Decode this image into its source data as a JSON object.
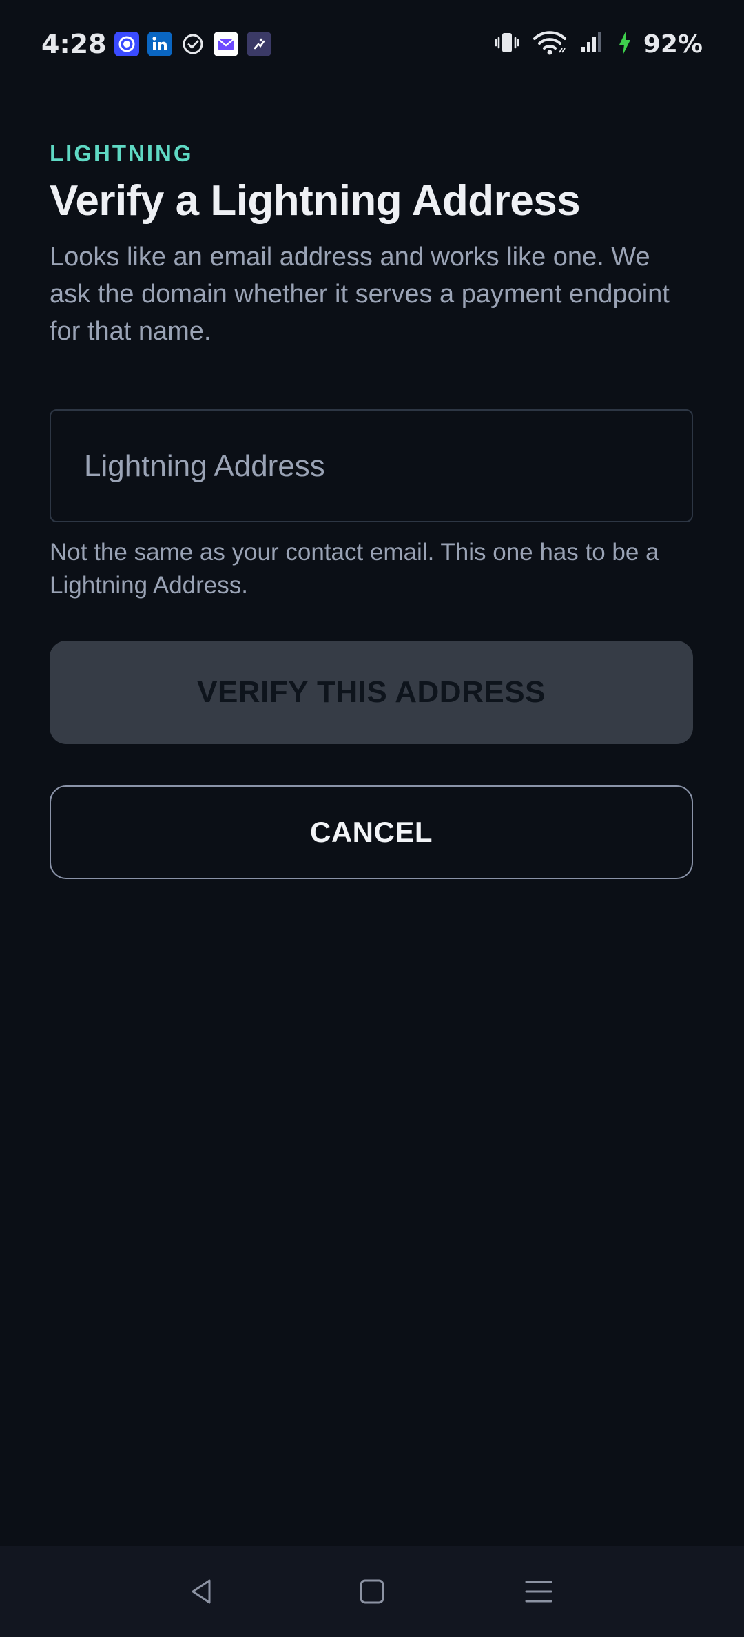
{
  "status_bar": {
    "time": "4:28",
    "battery": "92%",
    "notification_icons": [
      "signal-app-icon",
      "linkedin-icon",
      "tasks-check-icon",
      "mail-icon",
      "app-icon"
    ],
    "system_icons": [
      "vibrate-icon",
      "wifi-icon",
      "cell-signal-icon",
      "charging-bolt-icon"
    ]
  },
  "page": {
    "eyebrow": "LIGHTNING",
    "title": "Verify a Lightning Address",
    "subtitle": "Looks like an email address and works like one. We ask the domain whether it serves a payment endpoint for that name."
  },
  "form": {
    "address_input": {
      "placeholder": "Lightning Address",
      "value": ""
    },
    "helper_text": "Not the same as your contact email. This one has to be a Lightning Address."
  },
  "actions": {
    "verify_label": "VERIFY THIS ADDRESS",
    "cancel_label": "CANCEL"
  },
  "nav_bar": {
    "buttons": [
      "back-icon",
      "home-icon",
      "menu-icon"
    ]
  },
  "colors": {
    "background": "#0b0f16",
    "accent": "#5fd9c4",
    "title": "#eef0f4",
    "muted_text": "#9aa3b5",
    "disabled_button": "#363c46"
  }
}
